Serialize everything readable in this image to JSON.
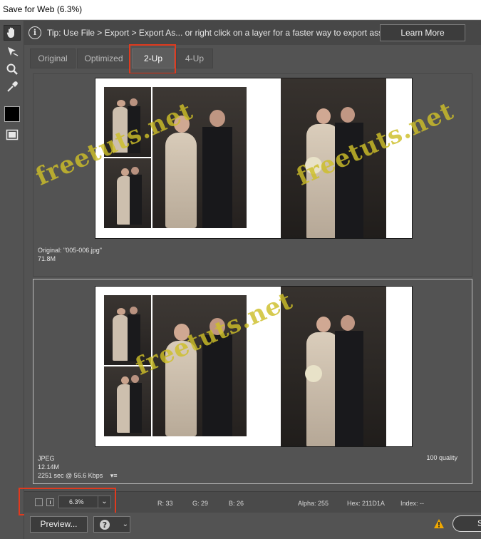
{
  "window": {
    "title": "Save for Web (6.3%)"
  },
  "tools": [
    "hand-tool-icon",
    "slice-select-tool-icon",
    "zoom-tool-icon",
    "eyedropper-tool-icon",
    "foreground-color-swatch",
    "toggle-slices-icon"
  ],
  "tip": {
    "text": "Tip: Use File > Export > Export As...  or right click on a layer for a faster way to export assets",
    "learn_more": "Learn More"
  },
  "tabs": [
    {
      "label": "Original"
    },
    {
      "label": "Optimized"
    },
    {
      "label": "2-Up"
    },
    {
      "label": "4-Up"
    }
  ],
  "selected_tab": "2-Up",
  "original_pane": {
    "label": "Original: \"005-006.jpg\"",
    "size": "71.8M"
  },
  "optimized_pane": {
    "format": "JPEG",
    "size": "12.14M",
    "time": "2251 sec @ 56.6 Kbps",
    "quality": "100 quality"
  },
  "status": {
    "zoom": "6.3%",
    "r": "R: 33",
    "g": "G: 29",
    "b": "B: 26",
    "alpha": "Alpha: 255",
    "hex": "Hex: 211D1A",
    "index": "Index: --"
  },
  "footer": {
    "preview": "Preview...",
    "save_partial": "S"
  },
  "watermark": "freetuts.net",
  "colors": {
    "highlight": "#e03a1e",
    "watermark": "#cdbe28",
    "warning": "#f0a800"
  }
}
